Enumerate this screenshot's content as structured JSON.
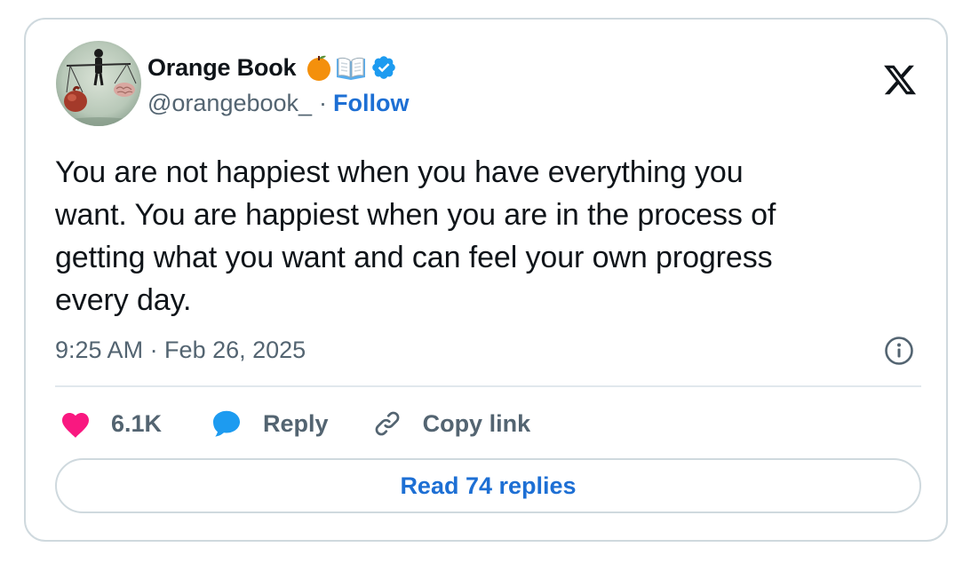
{
  "author": {
    "display_name": "Orange Book",
    "handle": "@orangebook_",
    "separator": "·",
    "follow_label": "Follow",
    "name_emojis": [
      "orange-icon",
      "open-book-icon"
    ],
    "verified": true,
    "avatar_icon": "balance-scale-heart-brain-icon"
  },
  "tweet": {
    "text": "You are not happiest when you have everything you\nwant. You are happiest when you are in the process of\ngetting what you want and can feel your own progress\nevery day.",
    "timestamp": "9:25 AM · Feb 26, 2025"
  },
  "actions": {
    "likes": "6.1K",
    "reply_label": "Reply",
    "copy_link_label": "Copy link"
  },
  "read_replies_label": "Read 74 replies",
  "colors": {
    "accent": "#1d6fd4",
    "verified": "#1d9bf0",
    "heart": "#f91880",
    "text": "#0f1419",
    "muted": "#536471",
    "border": "#cfd9de"
  }
}
